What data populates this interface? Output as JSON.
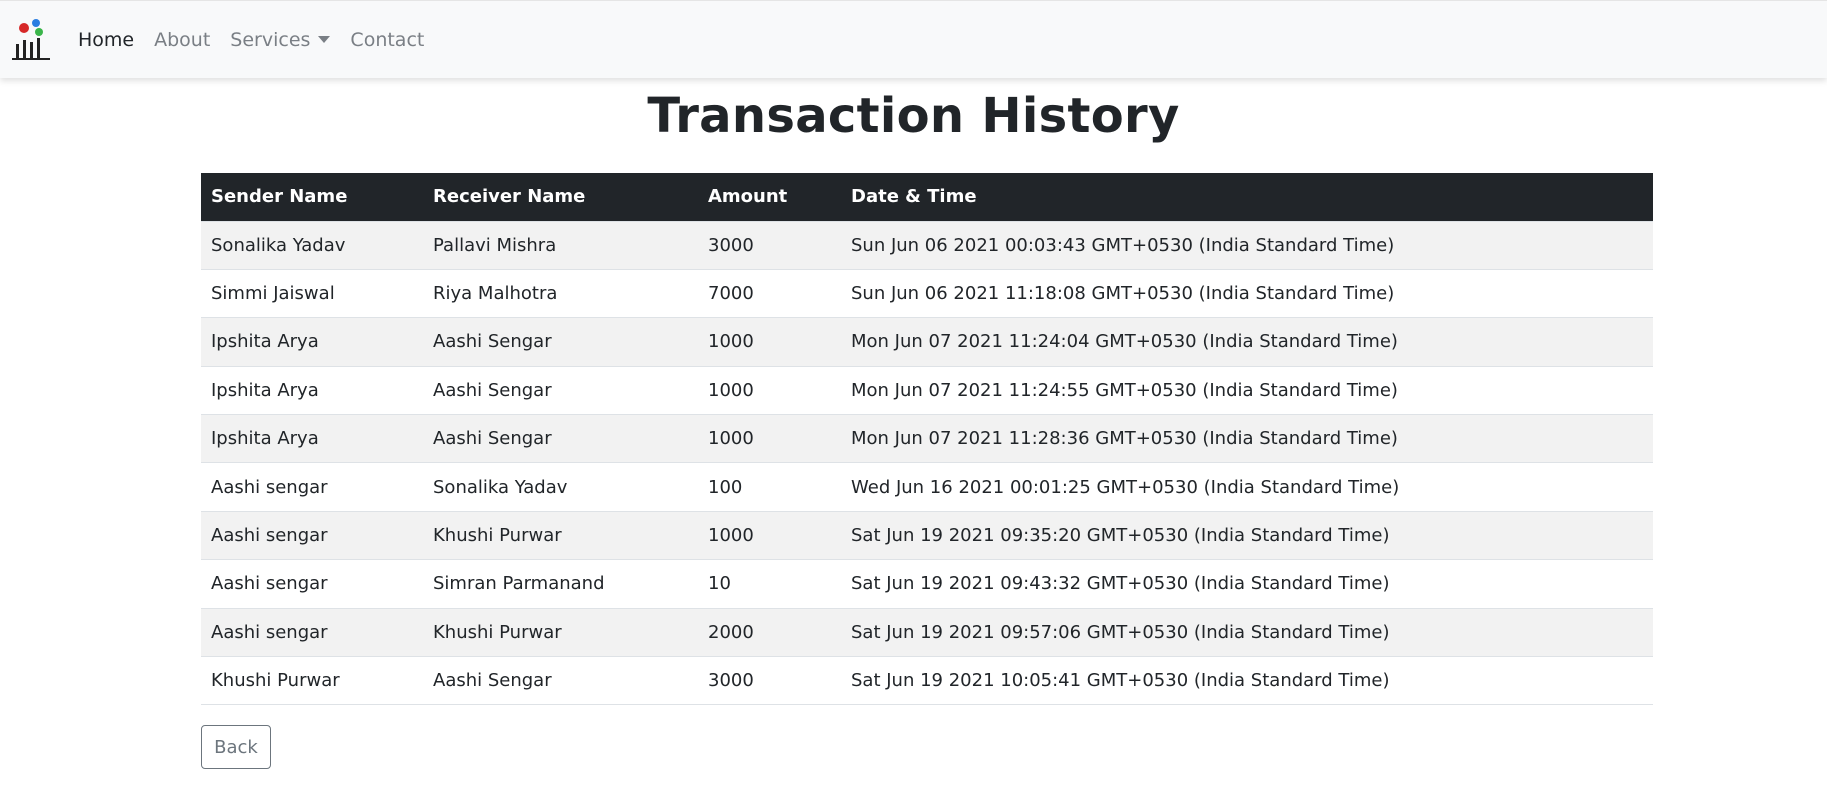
{
  "nav": {
    "items": [
      {
        "label": "Home"
      },
      {
        "label": "About"
      },
      {
        "label": "Services"
      },
      {
        "label": "Contact"
      }
    ]
  },
  "page": {
    "title": "Transaction History"
  },
  "table": {
    "headers": [
      "Sender Name",
      "Receiver Name",
      "Amount",
      "Date & Time"
    ],
    "rows": [
      [
        "Sonalika Yadav",
        "Pallavi Mishra",
        "3000",
        "Sun Jun 06 2021 00:03:43 GMT+0530 (India Standard Time)"
      ],
      [
        "Simmi Jaiswal",
        "Riya Malhotra",
        "7000",
        "Sun Jun 06 2021 11:18:08 GMT+0530 (India Standard Time)"
      ],
      [
        "Ipshita Arya",
        "Aashi Sengar",
        "1000",
        "Mon Jun 07 2021 11:24:04 GMT+0530 (India Standard Time)"
      ],
      [
        "Ipshita Arya",
        "Aashi Sengar",
        "1000",
        "Mon Jun 07 2021 11:24:55 GMT+0530 (India Standard Time)"
      ],
      [
        "Ipshita Arya",
        "Aashi Sengar",
        "1000",
        "Mon Jun 07 2021 11:28:36 GMT+0530 (India Standard Time)"
      ],
      [
        "Aashi sengar",
        "Sonalika Yadav",
        "100",
        "Wed Jun 16 2021 00:01:25 GMT+0530 (India Standard Time)"
      ],
      [
        "Aashi sengar",
        "Khushi Purwar",
        "1000",
        "Sat Jun 19 2021 09:35:20 GMT+0530 (India Standard Time)"
      ],
      [
        "Aashi sengar",
        "Simran Parmanand",
        "10",
        "Sat Jun 19 2021 09:43:32 GMT+0530 (India Standard Time)"
      ],
      [
        "Aashi sengar",
        "Khushi Purwar",
        "2000",
        "Sat Jun 19 2021 09:57:06 GMT+0530 (India Standard Time)"
      ],
      [
        "Khushi Purwar",
        "Aashi Sengar",
        "3000",
        "Sat Jun 19 2021 10:05:41 GMT+0530 (India Standard Time)"
      ]
    ]
  },
  "actions": {
    "back_label": "Back"
  },
  "colors": {
    "navbar_bg": "#f8f9fa",
    "header_bg": "#212529",
    "stripe": "#f2f2f2",
    "muted": "#6c757d"
  },
  "icons": {
    "logo": "bank-logo-icon",
    "services_dropdown": "caret-down-icon"
  }
}
